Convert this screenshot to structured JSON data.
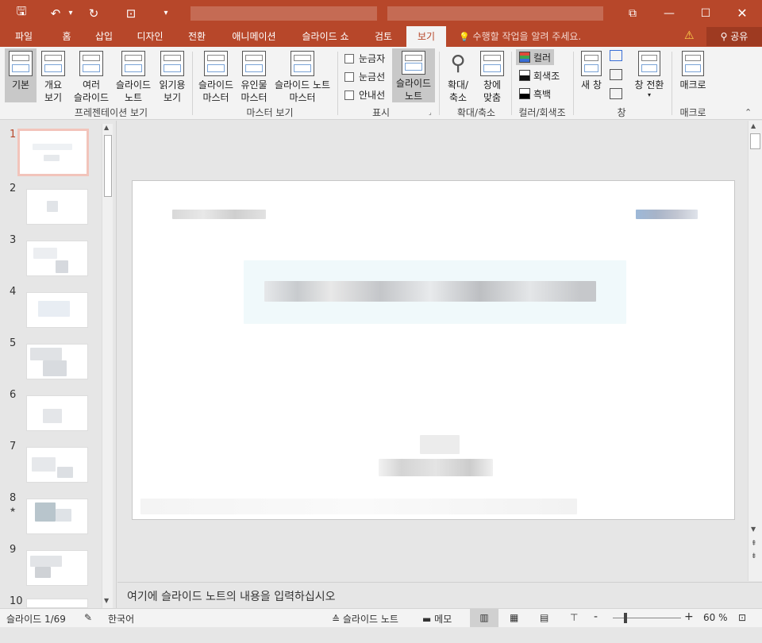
{
  "titlebar": {
    "quick_access": {
      "save": "🖫",
      "undo": "↶",
      "undo_drop": "▾",
      "redo": "↻",
      "present": "⊡",
      "customize": "▾"
    },
    "window": {
      "restore_ribbon": "⧉",
      "minimize": "—",
      "maximize": "☐",
      "close": "✕"
    }
  },
  "tabs": [
    {
      "label": "파일"
    },
    {
      "label": "홈"
    },
    {
      "label": "삽입"
    },
    {
      "label": "디자인"
    },
    {
      "label": "전환"
    },
    {
      "label": "애니메이션"
    },
    {
      "label": "슬라이드 쇼"
    },
    {
      "label": "검토"
    },
    {
      "label": "보기",
      "active": true
    }
  ],
  "tellme": {
    "icon": "💡",
    "text": "수행할 작업을 알려 주세요."
  },
  "share": {
    "label": "공유",
    "icon": "person-icon"
  },
  "ribbon": {
    "groups": {
      "presentation_views": "프레젠테이션 보기",
      "master_views": "마스터 보기",
      "show": "표시",
      "zoom": "확대/축소",
      "color": "컬러/회색조",
      "window": "창",
      "macros": "매크로"
    },
    "buttons": {
      "normal": [
        "기본"
      ],
      "outline": [
        "개요",
        "보기"
      ],
      "sorter": [
        "여러",
        "슬라이드"
      ],
      "notes_page": [
        "슬라이드",
        "노트"
      ],
      "reading": [
        "읽기용",
        "보기"
      ],
      "slide_master": [
        "슬라이드",
        "마스터"
      ],
      "handout_master": [
        "유인물",
        "마스터"
      ],
      "notes_master": [
        "슬라이드 노트",
        "마스터"
      ],
      "notes_toggle": [
        "슬라이드",
        "노트"
      ],
      "zoom": [
        "확대/",
        "축소"
      ],
      "fit": [
        "창에",
        "맞춤"
      ],
      "new_window": [
        "새 창"
      ],
      "switch": [
        "창 전환",
        "▾"
      ],
      "macros": [
        "매크로"
      ]
    },
    "checkboxes": {
      "ruler": "눈금자",
      "gridlines": "눈금선",
      "guides": "안내선"
    },
    "color_options": {
      "color": "컬러",
      "grayscale": "회색조",
      "bw": "흑백"
    }
  },
  "slides": [
    {
      "num": "1",
      "selected": true
    },
    {
      "num": "2"
    },
    {
      "num": "3"
    },
    {
      "num": "4"
    },
    {
      "num": "5"
    },
    {
      "num": "6"
    },
    {
      "num": "7"
    },
    {
      "num": "8",
      "star": "★"
    },
    {
      "num": "9"
    },
    {
      "num": "10"
    }
  ],
  "notes": {
    "placeholder": "여기에 슬라이드 노트의 내용을 입력하십시오"
  },
  "status": {
    "slide_count": "슬라이드 1/69",
    "language": "한국어",
    "notes_btn": "슬라이드 노트",
    "comments_btn": "메모",
    "zoom_minus": "-",
    "zoom_plus": "+",
    "zoom_level": "60 %"
  },
  "colors": {
    "accent": "#b7472a",
    "ribbon_bg": "#f3f3f3",
    "workspace": "#e6e6e6"
  }
}
